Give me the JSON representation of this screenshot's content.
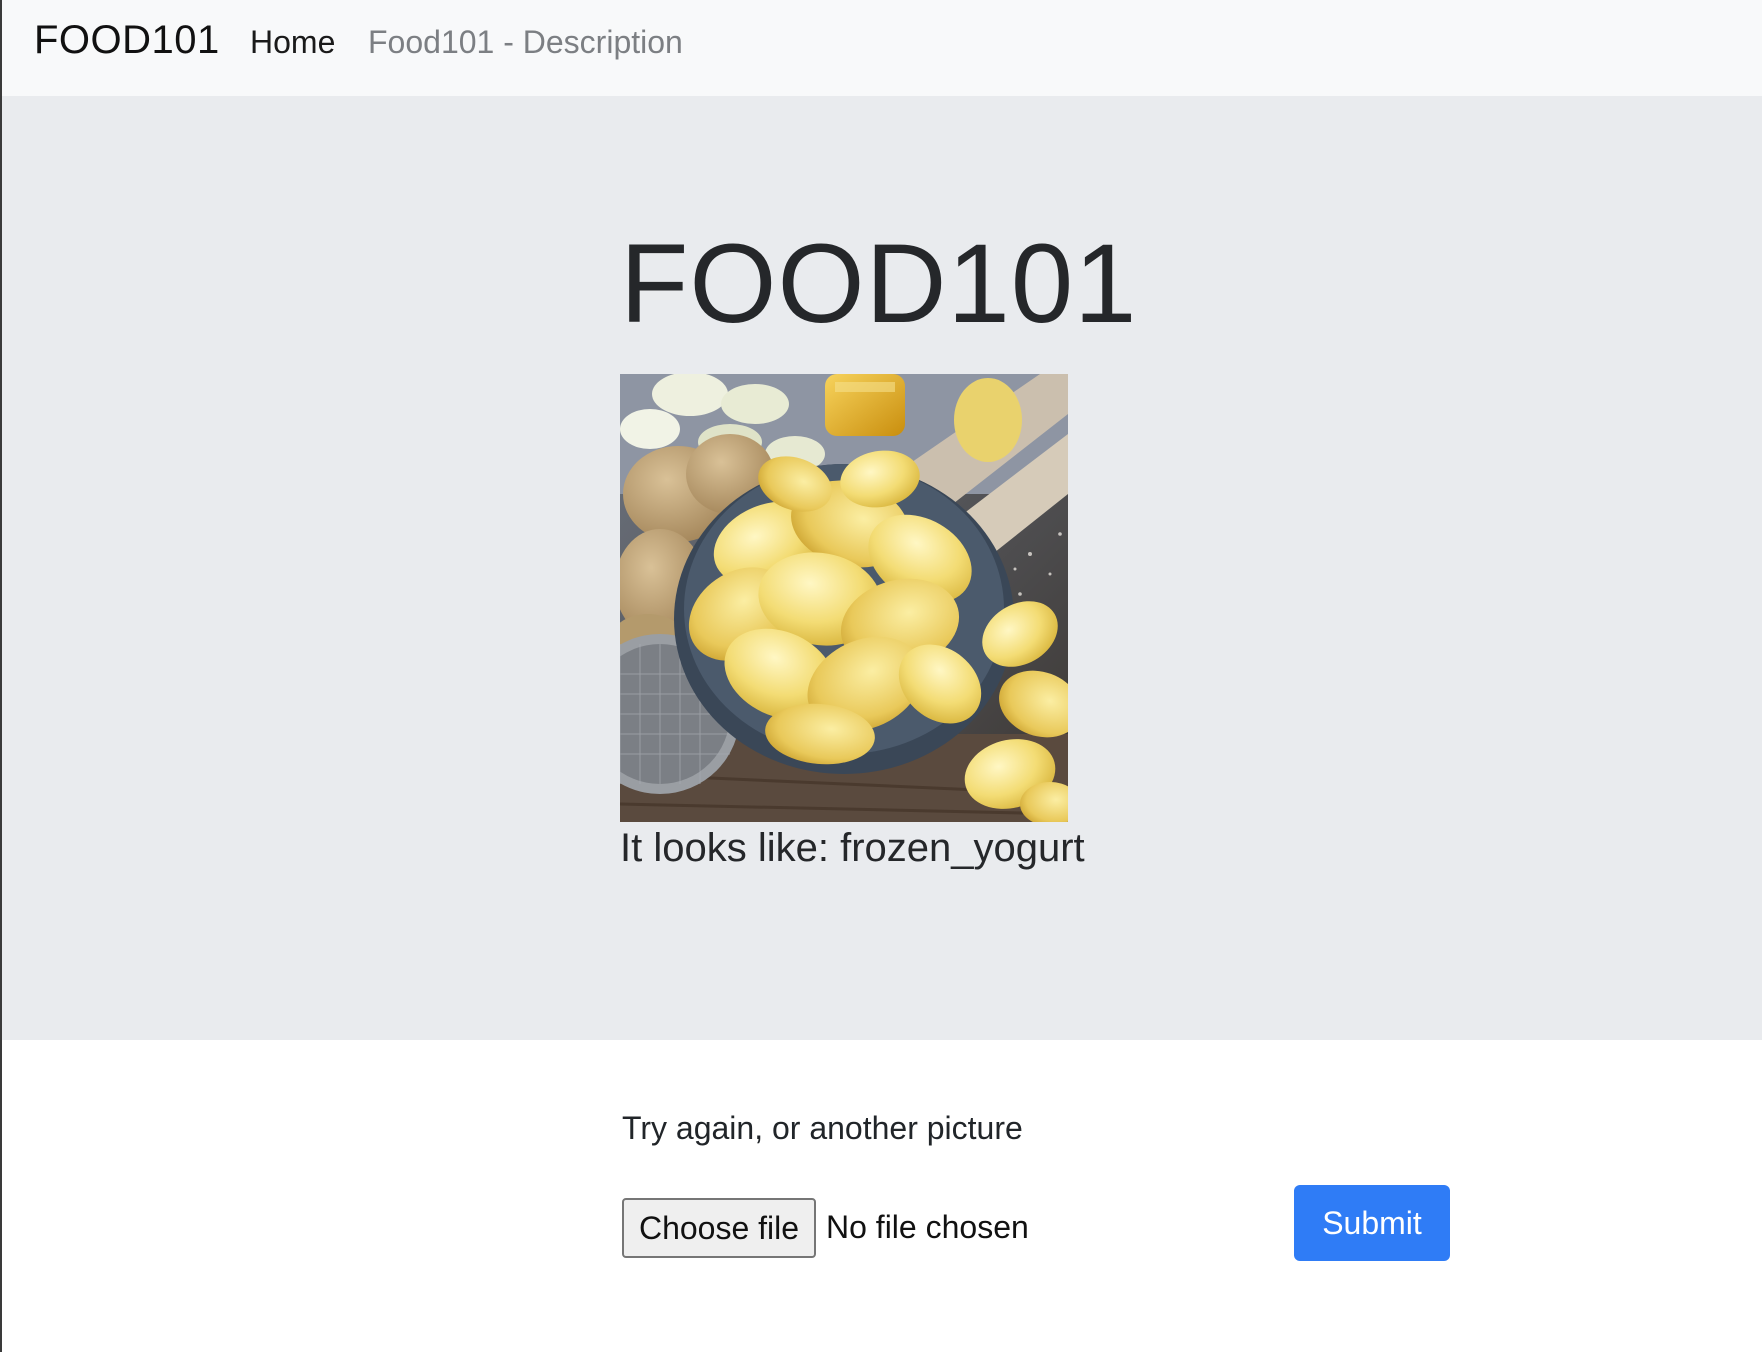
{
  "navbar": {
    "brand": "FOOD101",
    "links": [
      {
        "label": "Home"
      },
      {
        "label": "Food101 - Description"
      }
    ]
  },
  "hero": {
    "title": "FOOD101",
    "image_icon": "potato-chips-photo",
    "prediction": "It looks like: frozen_yogurt"
  },
  "upload": {
    "heading": "Try again, or another picture",
    "file_button_label": "Choose file",
    "file_status": "No file chosen",
    "submit_label": "Submit"
  },
  "colors": {
    "navbar_bg": "#f8f9fa",
    "jumbotron_bg": "#e9ebee",
    "submit_bg": "#2f7cf6",
    "nav_muted": "#7c7f83"
  }
}
